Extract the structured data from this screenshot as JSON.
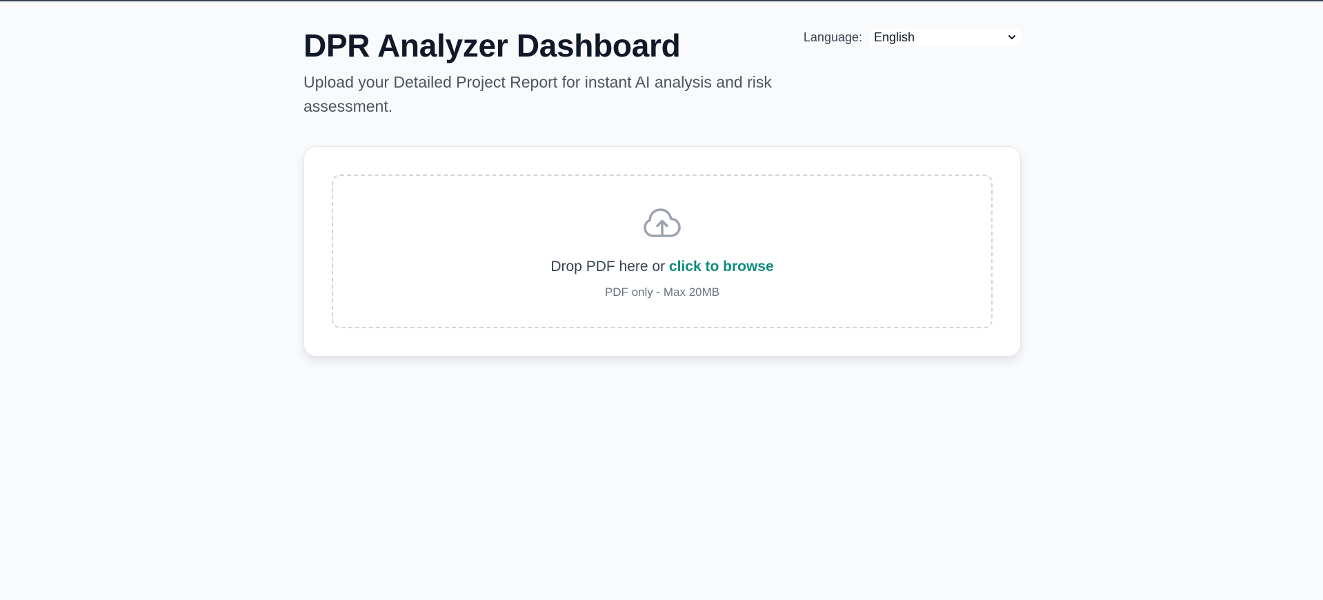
{
  "header": {
    "title": "DPR Analyzer Dashboard",
    "subtitle": "Upload your Detailed Project Report for instant AI analysis and risk assessment."
  },
  "language": {
    "label": "Language:",
    "selected": "English"
  },
  "upload": {
    "icon": "cloud-upload-icon",
    "prompt": "Drop PDF here or",
    "browse_label": "click to browse",
    "hint": "PDF only - Max 20MB"
  },
  "colors": {
    "accent": "#0f8b7e",
    "background": "#f8fafc",
    "title": "#111827"
  }
}
